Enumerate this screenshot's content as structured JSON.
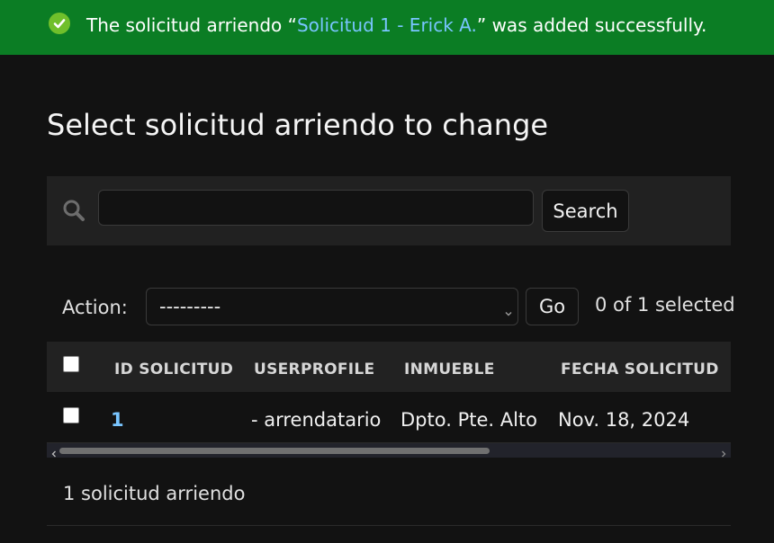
{
  "message": {
    "prefix": "The solicitud arriendo “",
    "link": "Solicitud 1 - Erick A.",
    "suffix": "” was added successfully.",
    "icon": "check-circle-icon",
    "bg_color": "#0b7d24"
  },
  "page_title": "Select solicitud arriendo to change",
  "search": {
    "icon": "search-icon",
    "value": "",
    "placeholder": "",
    "button_label": "Search"
  },
  "actions": {
    "label": "Action:",
    "selected": "---------",
    "go_label": "Go",
    "counter": "0 of 1 selected"
  },
  "table": {
    "columns": [
      "ID SOLICITUD",
      "USERPROFILE",
      "INMUEBLE",
      "FECHA SOLICITUD"
    ],
    "rows": [
      {
        "id": "1",
        "userprofile": "- arrendatario",
        "inmueble": "Dpto. Pte. Alto",
        "fecha": "Nov. 18, 2024"
      }
    ]
  },
  "result_count": "1 solicitud arriendo",
  "colors": {
    "background": "#121212",
    "link": "#79c5ff",
    "success": "#0b7d24"
  }
}
